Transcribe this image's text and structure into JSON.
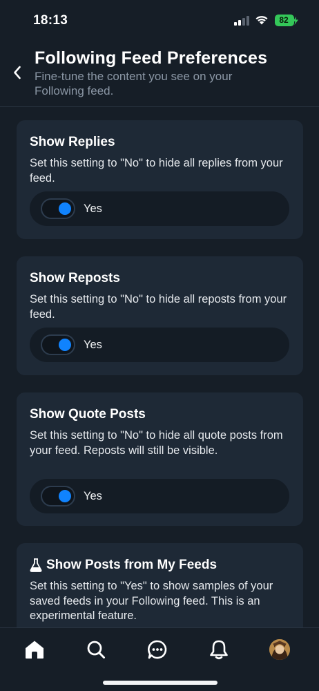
{
  "status_bar": {
    "time": "18:13",
    "battery": "82"
  },
  "header": {
    "title": "Following Feed Preferences",
    "subtitle": "Fine-tune the content you see on your Following feed."
  },
  "cards": [
    {
      "title": "Show Replies",
      "description": "Set this setting to \"No\" to hide all replies from your feed.",
      "toggle_label": "Yes",
      "toggle_on": true
    },
    {
      "title": "Show Reposts",
      "description": "Set this setting to \"No\" to hide all reposts from your feed.",
      "toggle_label": "Yes",
      "toggle_on": true
    },
    {
      "title": "Show Quote Posts",
      "description": "Set this setting to \"No\" to hide all quote posts from your feed. Reposts will still be visible.",
      "toggle_label": "Yes",
      "toggle_on": true
    },
    {
      "title": "Show Posts from My Feeds",
      "title_icon": "flask-icon",
      "description": "Set this setting to \"Yes\" to show samples of your saved feeds in your Following feed. This is an experimental feature."
    }
  ],
  "bottom_nav": {
    "items": [
      {
        "icon": "home-icon"
      },
      {
        "icon": "search-icon"
      },
      {
        "icon": "chat-icon"
      },
      {
        "icon": "bell-icon"
      },
      {
        "icon": "avatar"
      }
    ]
  },
  "colors": {
    "background": "#161e27",
    "card": "#1e2936",
    "accent": "#1083fe",
    "battery": "#34c759"
  }
}
